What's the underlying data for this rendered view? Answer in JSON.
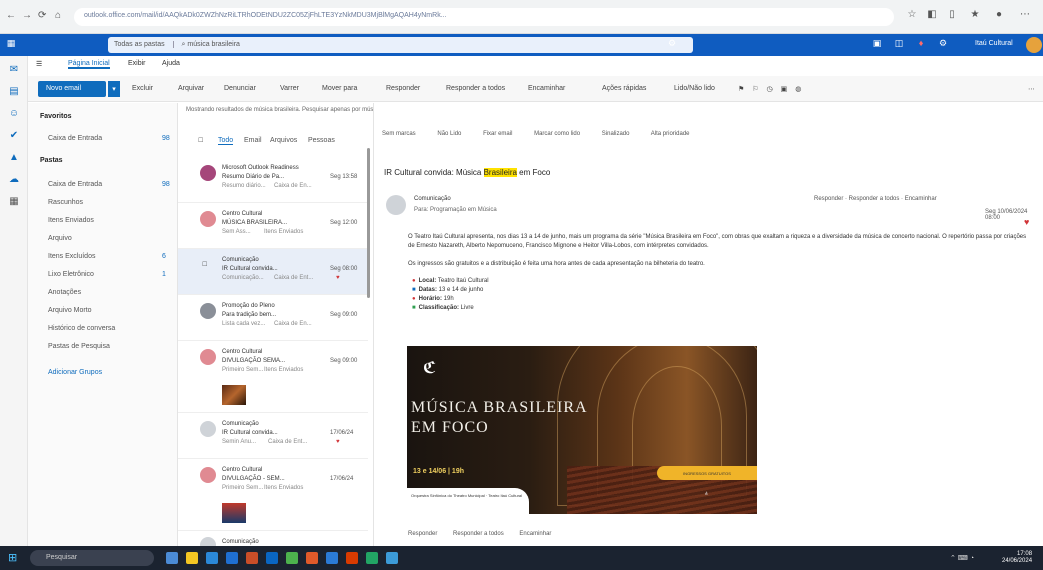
{
  "browser": {
    "url": "outlook.office.com/mail/id/AAQkADk0ZWZhNzRiLTRhODEtNDU2ZC05ZjFhLTE3YzNkMDU3MjBlMgAQAH4yNmRk..."
  },
  "header": {
    "search_scope": "Todas as pastas",
    "search_query": "música brasileira",
    "app_user": "Itaú Cultural",
    "brand_color": "#0f5cc0"
  },
  "ribbon": {
    "tabs": [
      "Página Inicial",
      "Exibir",
      "Ajuda"
    ],
    "new_mail": "Novo email",
    "buttons": [
      "Excluir",
      "Arquivar",
      "Denunciar",
      "Varrer",
      "Mover para",
      "Responder",
      "Responder a todos",
      "Encaminhar",
      "Ações rápidas",
      "Lido/Não lido"
    ]
  },
  "folders": {
    "favorites_header": "Favoritos",
    "favorites": [
      {
        "label": "Caixa de Entrada",
        "count": "98"
      }
    ],
    "folders_header": "Pastas",
    "items": [
      {
        "label": "Caixa de Entrada",
        "count": "98"
      },
      {
        "label": "Rascunhos",
        "count": ""
      },
      {
        "label": "Itens Enviados",
        "count": ""
      },
      {
        "label": "Arquivo",
        "count": ""
      },
      {
        "label": "Itens Excluídos",
        "count": "6"
      },
      {
        "label": "Lixo Eletrônico",
        "count": "1"
      },
      {
        "label": "Anotações",
        "count": ""
      },
      {
        "label": "Arquivo Morto",
        "count": ""
      },
      {
        "label": "Histórico de conversa",
        "count": ""
      },
      {
        "label": "Pastas de Pesquisa",
        "count": ""
      }
    ],
    "groups": "Adicionar Grupos"
  },
  "list": {
    "search_info": "Mostrando resultados de música brasileira. Pesquisar apenas por música brasileira",
    "filters": [
      "Todo",
      "Email",
      "Arquivos",
      "Pessoas"
    ],
    "messages": [
      {
        "from": "Microsoft Outlook Readiness",
        "subject": "Resumo Diário de Pa...",
        "preview": "Resumo diário...",
        "folder": "Caixa de En...",
        "date": "Seg 13:58"
      },
      {
        "from": "Centro Cultural",
        "subject": "MÚSICA BRASILEIRA...",
        "preview": "Sem Ass...",
        "folder": "Itens Enviados",
        "date": "Seg 12:00"
      },
      {
        "from": "Comunicação",
        "subject": "IR Cultural convida...",
        "preview": "Comunicação...",
        "folder": "Caixa de Ent...",
        "date": "Seg 08:00"
      },
      {
        "from": "Promoção do Pleno",
        "subject": "Para tradição bem...",
        "preview": "Lista cada vez...",
        "folder": "Caixa de En...",
        "date": "Seg 09:00"
      },
      {
        "from": "Centro Cultural",
        "subject": "DIVULGAÇÃO SEMA...",
        "preview": "Primeiro Sem...",
        "folder": "Itens Enviados",
        "date": "Seg 09:00"
      },
      {
        "from": "Comunicação",
        "subject": "IR Cultural convida...",
        "preview": "Semin Anu...",
        "folder": "Caixa de Ent...",
        "date": "17/06/24"
      },
      {
        "from": "Centro Cultural",
        "subject": "DIVULGAÇÃO - SEM...",
        "preview": "Primeiro Sem...",
        "folder": "Itens Enviados",
        "date": "17/06/24"
      },
      {
        "from": "Comunicação",
        "subject": "",
        "preview": "",
        "folder": "",
        "date": ""
      }
    ]
  },
  "reading": {
    "tags": "Sem Marca",
    "actions": [
      "Sem marcas",
      "Não Lido",
      "Fixar email",
      "Marcar como lido",
      "Sinalizado",
      "Alta prioridade"
    ],
    "subject": "IR Cultural convida: Música Brasileira em Foco",
    "sender": "Comunicação",
    "to": "Para: Programação em Música",
    "msg_actions": "Responder · Responder a todos · Encaminhar",
    "date": "Seg 10/06/2024 08:00",
    "body1": "O Teatro Itaú Cultural apresenta, nos dias 13 a 14 de junho, mais um programa da série \"Música Brasileira em Foco\", com obras que exaltam a riqueza e a diversidade da música de concerto nacional. O repertório passa por criações de Ernesto Nazareth, Alberto Nepomuceno, Francisco Mignone e Heitor Villa-Lobos, com intérpretes convidados.",
    "body2": "Os ingressos são gratuitos e a distribuição é feita uma hora antes de cada apresentação na bilheteria do teatro.",
    "details": [
      {
        "label": "Local:",
        "value": "Teatro Itaú Cultural"
      },
      {
        "label": "Datas:",
        "value": "13 e 14 de junho"
      },
      {
        "label": "Horário:",
        "value": "19h"
      },
      {
        "label": "Classificação:",
        "value": "Livre"
      }
    ],
    "banner": {
      "title_line1": "MÚSICA BRASILEIRA",
      "title_line2": "EM FOCO",
      "dates": "13 e 14/06 | 19h",
      "button": "INGRESSOS GRATUITOS",
      "footer": "Orquestra Sinfônica do Theatro Municipal · Teatro Itaú Cultural"
    },
    "reply_buttons": [
      "Responder",
      "Responder a todos",
      "Encaminhar"
    ]
  },
  "taskbar": {
    "search": "Pesquisar",
    "time": "17:08",
    "date": "24/06/2024"
  }
}
